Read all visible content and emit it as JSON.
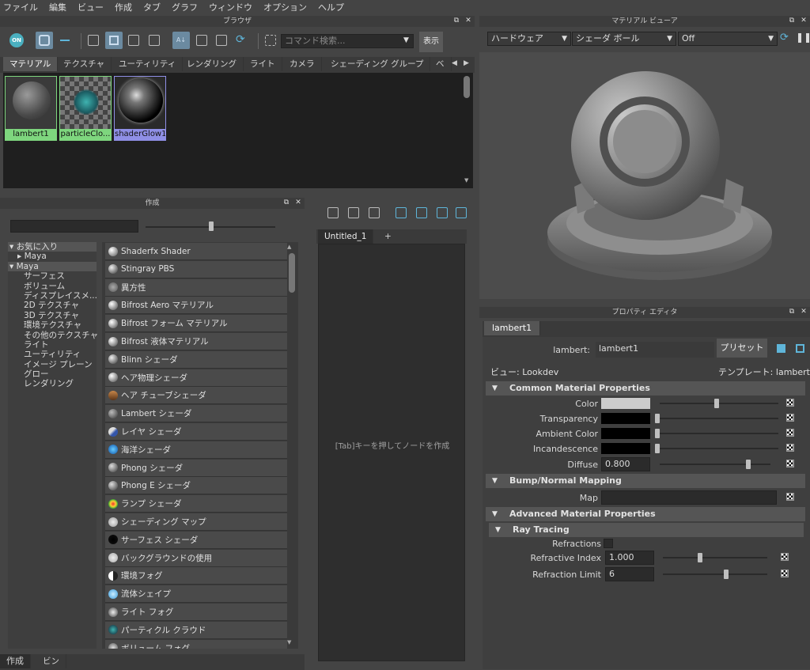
{
  "menu": [
    "ファイル",
    "編集",
    "ビュー",
    "作成",
    "タブ",
    "グラフ",
    "ウィンドウ",
    "オプション",
    "ヘルプ"
  ],
  "browser": {
    "title": "ブラウザ",
    "search_placeholder": "コマンド検索...",
    "show_btn": "表示",
    "on_label": "ON",
    "tabs": [
      "マテリアル",
      "テクスチャ",
      "ユーティリティ",
      "レンダリング",
      "ライト",
      "カメラ",
      "シェーディング グループ",
      "ベ"
    ],
    "swatches": [
      {
        "label": "lambert1",
        "color": "#7ed67e"
      },
      {
        "label": "particleClo...",
        "color": "#7ed67e"
      },
      {
        "label": "shaderGlow1",
        "color": "#8f8fe6"
      }
    ]
  },
  "create": {
    "title": "作成",
    "bottom_tabs": [
      "作成",
      "ビン"
    ],
    "tree": [
      "お気に入り",
      "Maya",
      "Maya",
      "サーフェス",
      "ボリューム",
      "ディスプレイスメ...",
      "2D テクスチャ",
      "3D テクスチャ",
      "環境テクスチャ",
      "その他のテクスチャ",
      "ライト",
      "ユーティリティ",
      "イメージ プレーン",
      "グロー",
      "レンダリング"
    ],
    "nodes": [
      "Shaderfx Shader",
      "Stingray PBS",
      "異方性",
      "Bifrost Aero マテリアル",
      "Bifrost フォーム マテリアル",
      "Bifrost 液体マテリアル",
      "Blinn シェーダ",
      "ヘア物理シェーダ",
      "ヘア チューブシェーダ",
      "Lambert シェーダ",
      "レイヤ シェーダ",
      "海洋シェーダ",
      "Phong シェーダ",
      "Phong E シェーダ",
      "ランプ シェーダ",
      "シェーディング マップ",
      "サーフェス シェーダ",
      "バックグラウンドの使用",
      "環境フォグ",
      "流体シェイプ",
      "ライト フォグ",
      "パーティクル クラウド",
      "ボリューム フォグ"
    ]
  },
  "graph": {
    "tab": "Untitled_1",
    "plus": "+",
    "hint": "[Tab]キーを押してノードを作成"
  },
  "viewer": {
    "title": "マテリアル ビューア",
    "renderer": "ハードウェア",
    "shape": "シェーダ ボール",
    "env": "Off"
  },
  "props": {
    "title": "プロパティ エディタ",
    "tab": "lambert1",
    "type_label": "lambert:",
    "name": "lambert1",
    "preset_btn": "プリセット",
    "view_label": "ビュー:",
    "view_value": "Lookdev",
    "template_label": "テンプレート:",
    "template_value": "lambert",
    "sec_common": "Common Material Properties",
    "color": "Color",
    "transparency": "Transparency",
    "ambient": "Ambient Color",
    "incandescence": "Incandescence",
    "diffuse": "Diffuse",
    "diffuse_value": "0.800",
    "sec_bump": "Bump/Normal Mapping",
    "map": "Map",
    "sec_adv": "Advanced Material Properties",
    "sec_ray": "Ray Tracing",
    "refractions": "Refractions",
    "ref_index": "Refractive Index",
    "ref_index_value": "1.000",
    "ref_limit": "Refraction Limit",
    "ref_limit_value": "6"
  }
}
